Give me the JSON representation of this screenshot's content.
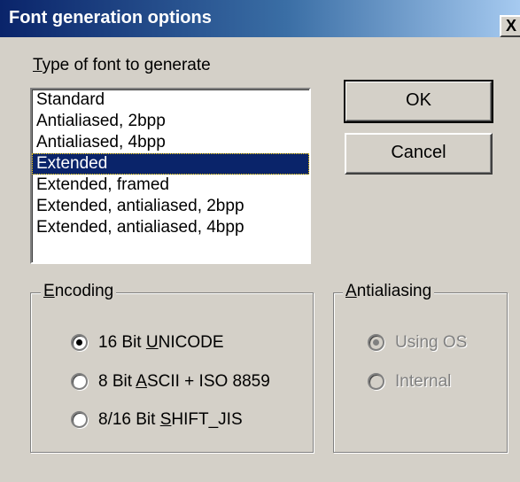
{
  "window": {
    "title": "Font generation options",
    "close_glyph": "X"
  },
  "font_type": {
    "label_mnemonic": "T",
    "label_rest": "ype of font to generate",
    "items": [
      "Standard",
      "Antialiased, 2bpp",
      "Antialiased, 4bpp",
      "Extended",
      "Extended, framed",
      "Extended, antialiased, 2bpp",
      "Extended, antialiased, 4bpp"
    ],
    "selected": "Extended"
  },
  "buttons": {
    "ok": "OK",
    "cancel": "Cancel"
  },
  "encoding": {
    "legend_mnemonic": "E",
    "legend_rest": "ncoding",
    "options": [
      {
        "pre": "16 Bit ",
        "mnemonic": "U",
        "post": "NICODE",
        "checked": true
      },
      {
        "pre": "8 Bit ",
        "mnemonic": "A",
        "post": "SCII + ISO 8859",
        "checked": false
      },
      {
        "pre": "8/16 Bit ",
        "mnemonic": "S",
        "post": "HIFT_JIS",
        "checked": false
      }
    ]
  },
  "antialiasing": {
    "legend_mnemonic": "A",
    "legend_rest": "ntialiasing",
    "enabled": false,
    "options": [
      {
        "label": "Using OS",
        "checked": true
      },
      {
        "label": "Internal",
        "checked": false
      }
    ]
  }
}
